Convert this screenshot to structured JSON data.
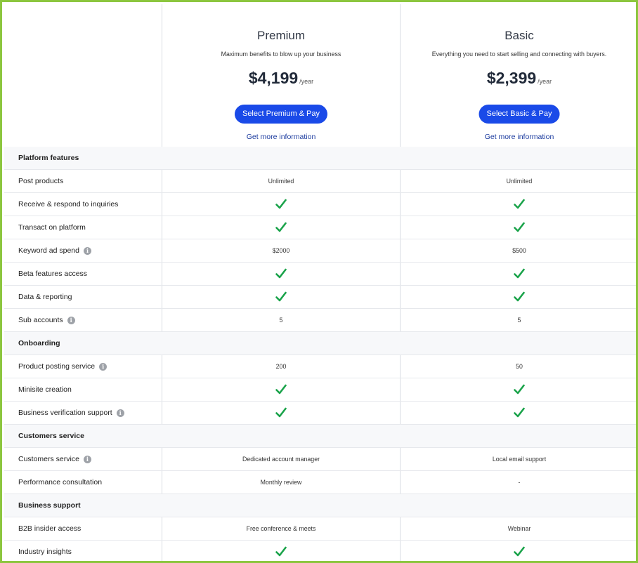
{
  "plans": [
    {
      "name": "Premium",
      "description": "Maximum benefits to blow up your business",
      "price": "$4,199",
      "period": "/year",
      "button_label": "Select Premium & Pay",
      "more_info": "Get more information"
    },
    {
      "name": "Basic",
      "description": "Everything you need to start selling and connecting with buyers.",
      "price": "$2,399",
      "period": "/year",
      "button_label": "Select Basic & Pay",
      "more_info": "Get more information"
    }
  ],
  "colors": {
    "accent": "#1a4ae8",
    "link": "#1a3a9e",
    "check": "#1aa34a",
    "frame": "#8cc63f",
    "info_icon": "#9ea2a8"
  },
  "rows": [
    {
      "type": "section",
      "label": "Platform features"
    },
    {
      "type": "item",
      "label": "Post products",
      "info": false,
      "premium": "Unlimited",
      "basic": "Unlimited"
    },
    {
      "type": "item",
      "label": "Receive & respond to inquiries",
      "info": false,
      "premium": "check",
      "basic": "check"
    },
    {
      "type": "item",
      "label": "Transact on platform",
      "info": false,
      "premium": "check",
      "basic": "check"
    },
    {
      "type": "item",
      "label": "Keyword ad spend",
      "info": true,
      "premium": "$2000",
      "basic": "$500"
    },
    {
      "type": "item",
      "label": "Beta features access",
      "info": false,
      "premium": "check",
      "basic": "check"
    },
    {
      "type": "item",
      "label": "Data & reporting",
      "info": false,
      "premium": "check",
      "basic": "check"
    },
    {
      "type": "item",
      "label": "Sub accounts",
      "info": true,
      "premium": "5",
      "basic": "5"
    },
    {
      "type": "section",
      "label": "Onboarding"
    },
    {
      "type": "item",
      "label": "Product posting service",
      "info": true,
      "premium": "200",
      "basic": "50"
    },
    {
      "type": "item",
      "label": "Minisite creation",
      "info": false,
      "premium": "check",
      "basic": "check"
    },
    {
      "type": "item",
      "label": "Business verification support",
      "info": true,
      "premium": "check",
      "basic": "check"
    },
    {
      "type": "section",
      "label": "Customers service"
    },
    {
      "type": "item",
      "label": "Customers service",
      "info": true,
      "premium": "Dedicated account manager",
      "basic": "Local email support"
    },
    {
      "type": "item",
      "label": "Performance consultation",
      "info": false,
      "premium": "Monthly review",
      "basic": "-"
    },
    {
      "type": "section",
      "label": "Business support"
    },
    {
      "type": "item",
      "label": "B2B insider access",
      "info": false,
      "premium": "Free conference & meets",
      "basic": "Webinar"
    },
    {
      "type": "item",
      "label": "Industry insights",
      "info": false,
      "premium": "check",
      "basic": "check"
    }
  ],
  "icons": {
    "check": "check-icon",
    "info": "info-icon",
    "info_glyph": "i"
  }
}
